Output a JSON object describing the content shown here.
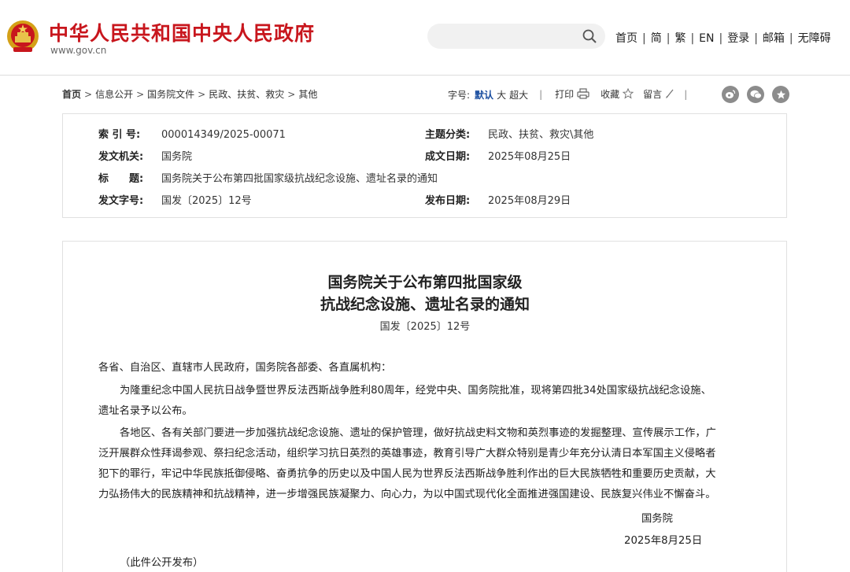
{
  "header": {
    "site_title": "中华人民共和国中央人民政府",
    "site_url": "www.gov.cn",
    "search_placeholder": "",
    "nav": [
      "首页",
      "简",
      "繁",
      "EN",
      "登录",
      "邮箱",
      "无障碍"
    ]
  },
  "breadcrumb": {
    "items": [
      "首页",
      "信息公开",
      "国务院文件",
      "民政、扶贫、救灾",
      "其他"
    ]
  },
  "tools": {
    "font_label": "字号:",
    "font_default": "默认",
    "font_large": "大",
    "font_xlarge": "超大",
    "print": "打印",
    "favorite": "收藏",
    "comment": "留言"
  },
  "meta": {
    "index_label": "索 引 号:",
    "index_value": "000014349/2025-00071",
    "category_label": "主题分类:",
    "category_value": "民政、扶贫、救灾\\其他",
    "issuer_label": "发文机关:",
    "issuer_value": "国务院",
    "written_label": "成文日期:",
    "written_value": "2025年08月25日",
    "title_label": "标　　题:",
    "title_value": "国务院关于公布第四批国家级抗战纪念设施、遗址名录的通知",
    "docno_label": "发文字号:",
    "docno_value": "国发〔2025〕12号",
    "published_label": "发布日期:",
    "published_value": "2025年08月29日"
  },
  "article": {
    "title_line1": "国务院关于公布第四批国家级",
    "title_line2": "抗战纪念设施、遗址名录的通知",
    "doc_number": "国发〔2025〕12号",
    "salutation": "各省、自治区、直辖市人民政府，国务院各部委、各直属机构：",
    "p1_line1": "为隆重纪念中国人民抗日战争暨世界反法西斯战争胜利80周年，经党中央、国务院批准，现将第四批34处国家级抗战纪念设施、",
    "p1_line2": "遗址名录予以公布。",
    "p2_line1": "各地区、各有关部门要进一步加强抗战纪念设施、遗址的保护管理，做好抗战史料文物和英烈事迹的发掘整理、宣传展示工作，广",
    "p2_line2": "泛开展群众性拜谒参观、祭扫纪念活动，组织学习抗日英烈的英雄事迹，教育引导广大群众特别是青少年充分认清日本军国主义侵略者",
    "p2_line3": "犯下的罪行，牢记中华民族抵御侵略、奋勇抗争的历史以及中国人民为世界反法西斯战争胜利作出的巨大民族牺牲和重要历史贡献，大",
    "p2_line4": "力弘扬伟大的民族精神和抗战精神，进一步增强民族凝聚力、向心力，为以中国式现代化全面推进强国建设、民族复兴伟业不懈奋斗。",
    "signer": "国务院",
    "sign_date": "2025年8月25日",
    "note": "（此件公开发布）"
  },
  "colors": {
    "brand_red": "#c8161d",
    "link_blue": "#1a4ea0",
    "border_gray": "#e1e1e1"
  },
  "icons": [
    "emblem-icon",
    "search-icon",
    "print-icon",
    "star-icon",
    "pencil-icon",
    "weibo-icon",
    "wechat-icon",
    "share-icon"
  ]
}
